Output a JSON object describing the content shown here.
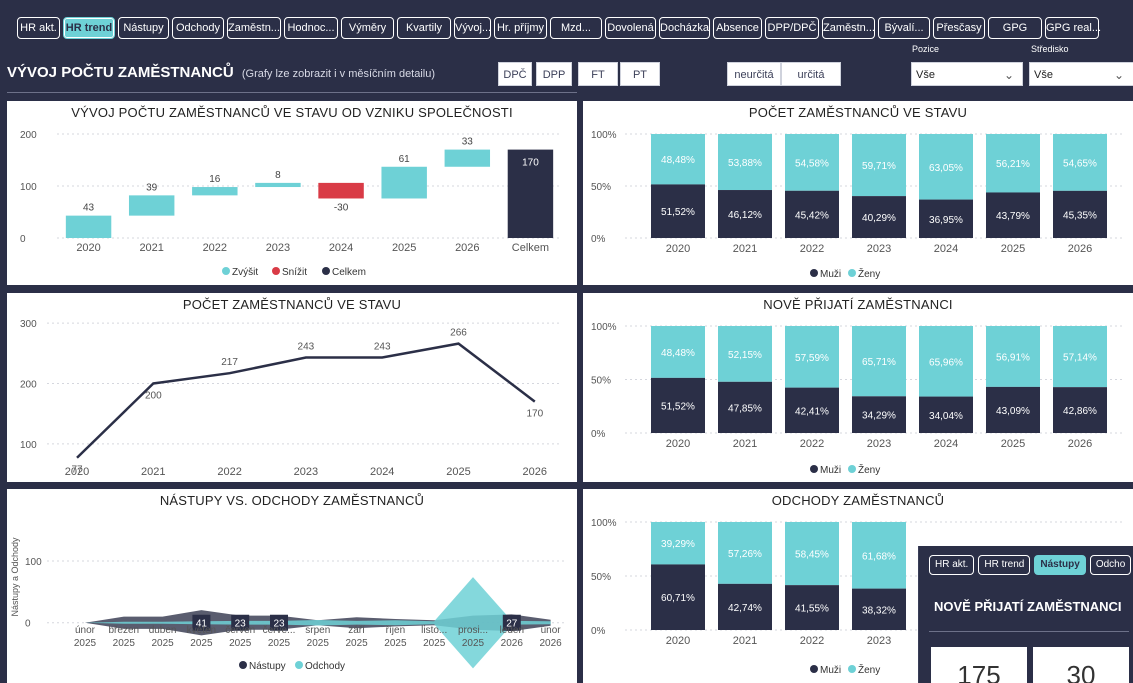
{
  "nav": {
    "tabs": [
      {
        "label": "HR akt.",
        "w": 43
      },
      {
        "label": "HR trend",
        "w": 52,
        "active": true
      },
      {
        "label": "Nástupy",
        "w": 51
      },
      {
        "label": "Odchody",
        "w": 52
      },
      {
        "label": "Zaměstn...",
        "w": 54
      },
      {
        "label": "Hodnoc...",
        "w": 54
      },
      {
        "label": "Výměry",
        "w": 53
      },
      {
        "label": "Kvartily",
        "w": 54
      },
      {
        "label": "Vývoj...",
        "w": 37
      },
      {
        "label": "Hr. příjmy",
        "w": 53
      },
      {
        "label": "Mzd...",
        "w": 52
      },
      {
        "label": "Dovolená",
        "w": 51
      },
      {
        "label": "Docházka",
        "w": 51
      },
      {
        "label": "Absence",
        "w": 49
      },
      {
        "label": "DPP/DPČ",
        "w": 54
      },
      {
        "label": "Zaměstn...",
        "w": 53
      },
      {
        "label": "Bývalí...",
        "w": 52
      },
      {
        "label": "Přesčasy",
        "w": 52
      },
      {
        "label": "GPG",
        "w": 54
      },
      {
        "label": "GPG real...",
        "w": 54
      }
    ]
  },
  "header": {
    "title": "VÝVOJ POČTU ZAMĚSTNANCŮ",
    "subtitle": "(Grafy lze zobrazit i v měsíčním detailu)",
    "type_buttons": [
      "DPČ",
      "DPP",
      "FT",
      "PT"
    ],
    "term_buttons": [
      "neurčitá",
      "určitá"
    ],
    "slicers": [
      {
        "label": "Pozice",
        "value": "Vše"
      },
      {
        "label": "Středisko",
        "value": "Vše"
      }
    ]
  },
  "chart_data": [
    {
      "type": "waterfall",
      "title": "VÝVOJ POČTU ZAMĚSTNANCŮ VE STAVU OD VZNIKU SPOLEČNOSTI",
      "categories": [
        "2020",
        "2021",
        "2022",
        "2023",
        "2024",
        "2025",
        "2026",
        "Celkem"
      ],
      "values": [
        43,
        39,
        16,
        8,
        -30,
        61,
        33,
        170
      ],
      "kinds": [
        "inc",
        "inc",
        "inc",
        "inc",
        "dec",
        "inc",
        "inc",
        "total"
      ],
      "ylim": [
        0,
        200
      ],
      "yticks": [
        0,
        100,
        200
      ],
      "legend": [
        "Zvýšit",
        "Snížit",
        "Celkem"
      ],
      "colors": {
        "inc": "#6ed1d6",
        "dec": "#d93b46",
        "total": "#2b2f47"
      }
    },
    {
      "type": "bar",
      "stacked_percent": true,
      "title": "POČET ZAMĚSTNANCŮ VE STAVU",
      "categories": [
        "2020",
        "2021",
        "2022",
        "2023",
        "2024",
        "2025",
        "2026"
      ],
      "series": [
        {
          "name": "Muži",
          "values": [
            "51,52%",
            "46,12%",
            "45,42%",
            "40,29%",
            "36,95%",
            "43,79%",
            "45,35%"
          ],
          "color": "#2b2f47"
        },
        {
          "name": "Ženy",
          "values": [
            "48,48%",
            "53,88%",
            "54,58%",
            "59,71%",
            "63,05%",
            "56,21%",
            "54,65%"
          ],
          "color": "#6ed1d6"
        }
      ],
      "yticks": [
        "0%",
        "50%",
        "100%"
      ],
      "legend": [
        "Muži",
        "Ženy"
      ]
    },
    {
      "type": "line",
      "title": "POČET ZAMĚSTNANCŮ VE STAVU",
      "categories": [
        "2020",
        "2021",
        "2022",
        "2023",
        "2024",
        "2025",
        "2026"
      ],
      "values": [
        77,
        200,
        217,
        243,
        243,
        266,
        170
      ],
      "ylim": [
        60,
        320
      ],
      "yticks": [
        100,
        200,
        300
      ],
      "color": "#2b2f47"
    },
    {
      "type": "bar",
      "stacked_percent": true,
      "title": "NOVĚ PŘIJATÍ ZAMĚSTNANCI",
      "categories": [
        "2020",
        "2021",
        "2022",
        "2023",
        "2024",
        "2025",
        "2026"
      ],
      "series": [
        {
          "name": "Muži",
          "values": [
            "51,52%",
            "47,85%",
            "42,41%",
            "34,29%",
            "34,04%",
            "43,09%",
            "42,86%"
          ],
          "color": "#2b2f47"
        },
        {
          "name": "Ženy",
          "values": [
            "48,48%",
            "52,15%",
            "57,59%",
            "65,71%",
            "65,96%",
            "56,91%",
            "57,14%"
          ],
          "color": "#6ed1d6"
        }
      ],
      "yticks": [
        "0%",
        "50%",
        "100%"
      ],
      "legend": [
        "Muži",
        "Ženy"
      ]
    },
    {
      "type": "area",
      "title": "NÁSTUPY VS. ODCHODY ZAMĚSTNANCŮ",
      "ylabel": "Nástupy a Odchody",
      "categories": [
        "únor 2025",
        "březen 2025",
        "duben 2025",
        "květen 2025",
        "červen 2025",
        "červe... 2025",
        "srpen 2025",
        "září 2025",
        "říjen 2025",
        "listo... 2025",
        "prosi... 2025",
        "leden 2026",
        "únor 2026"
      ],
      "series": [
        {
          "name": "Nástupy",
          "values": [
            0,
            20,
            20,
            41,
            23,
            23,
            8,
            18,
            12,
            8,
            23,
            27,
            10
          ],
          "color": "#2b2f47"
        },
        {
          "name": "Odchody",
          "values": [
            0,
            3,
            3,
            5,
            6,
            6,
            9,
            6,
            8,
            5,
            148,
            6,
            5
          ],
          "color": "#6ed1d6"
        }
      ],
      "data_labels": [
        {
          "i": 3,
          "text": "41"
        },
        {
          "i": 4,
          "text": "23"
        },
        {
          "i": 5,
          "text": "23"
        },
        {
          "i": 11,
          "text": "27"
        }
      ],
      "ylim": [
        -15,
        160
      ],
      "yticks": [
        0,
        100
      ],
      "legend": [
        "Nástupy",
        "Odchody"
      ]
    },
    {
      "type": "bar",
      "stacked_percent": true,
      "title": "ODCHODY ZAMĚSTNANCŮ",
      "categories": [
        "2020",
        "2021",
        "2022",
        "2023"
      ],
      "series": [
        {
          "name": "Muži",
          "values": [
            "60,71%",
            "42,74%",
            "41,55%",
            "38,32%"
          ],
          "color": "#2b2f47"
        },
        {
          "name": "Ženy",
          "values": [
            "39,29%",
            "57,26%",
            "58,45%",
            "61,68%"
          ],
          "color": "#6ed1d6"
        }
      ],
      "yticks": [
        "0%",
        "50%",
        "100%"
      ],
      "legend": [
        "Muži",
        "Ženy"
      ]
    }
  ],
  "overlay": {
    "tabs": [
      "HR akt.",
      "HR trend",
      "Nástupy",
      "Odcho"
    ],
    "active_tab": 2,
    "title": "NOVĚ PŘIJATÍ ZAMĚSTNANCI",
    "kpis": [
      "175",
      "30"
    ]
  }
}
